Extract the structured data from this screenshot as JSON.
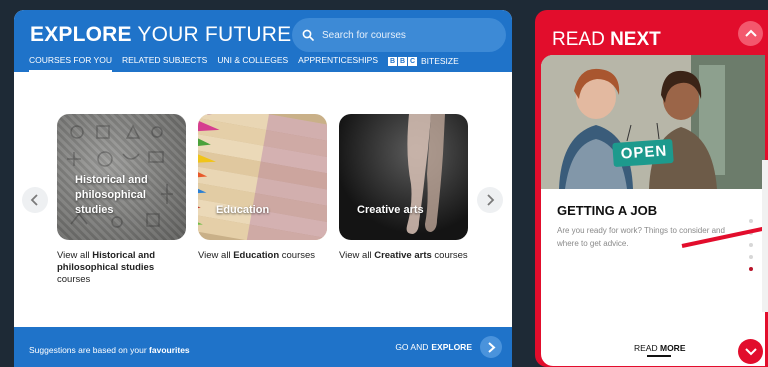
{
  "explore": {
    "title_bold": "EXPLORE",
    "title_rest": " YOUR FUTURE",
    "search_placeholder": "Search for courses",
    "tabs": [
      "COURSES FOR YOU",
      "RELATED SUBJECTS",
      "UNI & COLLEGES",
      "APPRENTICESHIPS"
    ],
    "bbc_letters": [
      "B",
      "B",
      "C"
    ],
    "bbc_tab": "BITESIZE",
    "cards": [
      {
        "label": "Historical and philosophical studies",
        "view_prefix": "View all ",
        "view_bold": "Historical and philosophical studies",
        "view_suffix": " courses"
      },
      {
        "label": "Education",
        "view_prefix": "View all ",
        "view_bold": "Education",
        "view_suffix": " courses"
      },
      {
        "label": "Creative arts",
        "view_prefix": "View all ",
        "view_bold": "Creative arts",
        "view_suffix": " courses"
      }
    ],
    "footer_note": "Suggestions are based on your ",
    "footer_note_bold": "favourites",
    "go_text": "GO AND",
    "go_bold": "EXPLORE"
  },
  "read_next": {
    "title_light": "READ ",
    "title_bold": "NEXT",
    "open_sign": "OPEN",
    "heading": "GETTING A JOB",
    "description": "Are you ready for work? Things to consider and where to get advice.",
    "read_text": "READ ",
    "read_bold": "MORE"
  },
  "colors": {
    "explore_blue": "#1f73c9",
    "read_next_red": "#e20d2c",
    "background": "#1e2a36"
  }
}
